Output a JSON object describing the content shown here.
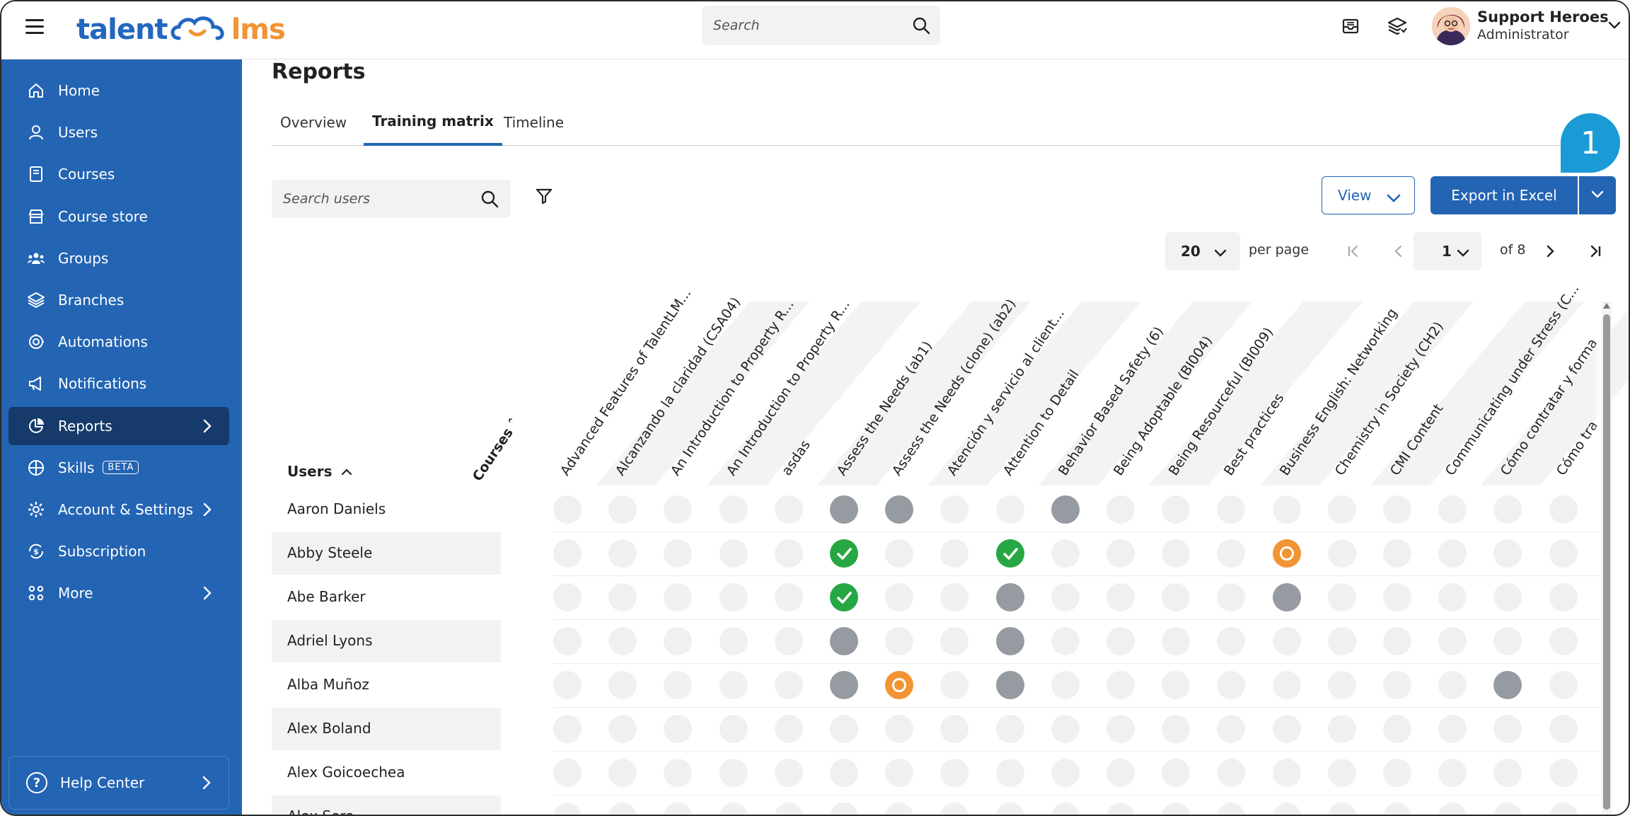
{
  "app": {
    "logo_left": "talent",
    "logo_right": "lms"
  },
  "topbar": {
    "search_placeholder": "Search",
    "user_name": "Support Heroes",
    "user_role": "Administrator"
  },
  "sidebar": {
    "items": [
      {
        "label": "Home",
        "icon": "home-icon"
      },
      {
        "label": "Users",
        "icon": "user-icon"
      },
      {
        "label": "Courses",
        "icon": "book-icon"
      },
      {
        "label": "Course store",
        "icon": "store-icon"
      },
      {
        "label": "Groups",
        "icon": "groups-icon"
      },
      {
        "label": "Branches",
        "icon": "layers-icon"
      },
      {
        "label": "Automations",
        "icon": "automation-icon"
      },
      {
        "label": "Notifications",
        "icon": "megaphone-icon"
      },
      {
        "label": "Reports",
        "icon": "pie-chart-icon",
        "active": true
      },
      {
        "label": "Skills",
        "icon": "skills-icon",
        "badge": "BETA"
      },
      {
        "label": "Account & Settings",
        "icon": "gear-icon"
      },
      {
        "label": "Subscription",
        "icon": "subscription-icon"
      },
      {
        "label": "More",
        "icon": "grid-icon"
      }
    ],
    "help_center": "Help Center"
  },
  "main": {
    "title": "Reports",
    "tabs": [
      "Overview",
      "Training matrix",
      "Timeline"
    ],
    "active_tab": "Training matrix",
    "search_users_placeholder": "Search users",
    "view_label": "View",
    "export_label": "Export in Excel",
    "callout_number": "1",
    "per_page_value": "20",
    "per_page_label": "per page",
    "page_value": "1",
    "page_of": "of 8"
  },
  "matrix": {
    "courses_label": "Courses",
    "users_label": "Users",
    "courses": [
      "Advanced Features of TalentLM...",
      "Alcanzando la claridad (CSA04)",
      "An Introduction to Property R...",
      "An Introduction to Property R...",
      "asdas",
      "Assess the Needs (ab1)",
      "Assess the Needs (clone) (ab2)",
      "Atención y servicio al client...",
      "Attention to Detail",
      "Behavior Based Safety (6)",
      "Being Adoptable (BI004)",
      "Being Resourceful (BI009)",
      "Best practices",
      "Business English: Networking",
      "Chemistry in Society (CH2)",
      "CMI Content",
      "Communicating under Stress (C...",
      "Cómo contratar y forma",
      "Cómo tra"
    ],
    "users": [
      "Aaron Daniels",
      "Abby Steele",
      "Abe Barker",
      "Adriel Lyons",
      "Alba Muñoz",
      "Alex Boland",
      "Alex Goicoechea",
      "Alex Sero"
    ],
    "statuses": [
      [
        "e",
        "e",
        "e",
        "e",
        "e",
        "g",
        "g",
        "e",
        "e",
        "g",
        "e",
        "e",
        "e",
        "e",
        "e",
        "e",
        "e",
        "e",
        "e"
      ],
      [
        "e",
        "e",
        "e",
        "e",
        "e",
        "c",
        "e",
        "e",
        "c",
        "e",
        "e",
        "e",
        "e",
        "p",
        "e",
        "e",
        "e",
        "e",
        "e"
      ],
      [
        "e",
        "e",
        "e",
        "e",
        "e",
        "c",
        "e",
        "e",
        "g",
        "e",
        "e",
        "e",
        "e",
        "g",
        "e",
        "e",
        "e",
        "e",
        "e"
      ],
      [
        "e",
        "e",
        "e",
        "e",
        "e",
        "g",
        "e",
        "e",
        "g",
        "e",
        "e",
        "e",
        "e",
        "e",
        "e",
        "e",
        "e",
        "e",
        "e"
      ],
      [
        "e",
        "e",
        "e",
        "e",
        "e",
        "g",
        "p",
        "e",
        "g",
        "e",
        "e",
        "e",
        "e",
        "e",
        "e",
        "e",
        "e",
        "g",
        "e"
      ],
      [
        "e",
        "e",
        "e",
        "e",
        "e",
        "e",
        "e",
        "e",
        "e",
        "e",
        "e",
        "e",
        "e",
        "e",
        "e",
        "e",
        "e",
        "e",
        "e"
      ],
      [
        "e",
        "e",
        "e",
        "e",
        "e",
        "e",
        "e",
        "e",
        "e",
        "e",
        "e",
        "e",
        "e",
        "e",
        "e",
        "e",
        "e",
        "e",
        "e"
      ],
      [
        "e",
        "e",
        "e",
        "e",
        "e",
        "e",
        "e",
        "e",
        "e",
        "e",
        "e",
        "e",
        "e",
        "e",
        "e",
        "e",
        "e",
        "e",
        "e"
      ]
    ],
    "status_legend": {
      "e": "not-enrolled",
      "g": "not-started",
      "c": "completed",
      "p": "in-progress"
    },
    "colors": {
      "empty": "#f0f0f0",
      "gray": "#959ba1",
      "green": "#27a743",
      "orange": "#f29433",
      "brand_blue": "#2364b3",
      "brand_orange": "#f29433",
      "callout": "#1b9bd6"
    }
  }
}
